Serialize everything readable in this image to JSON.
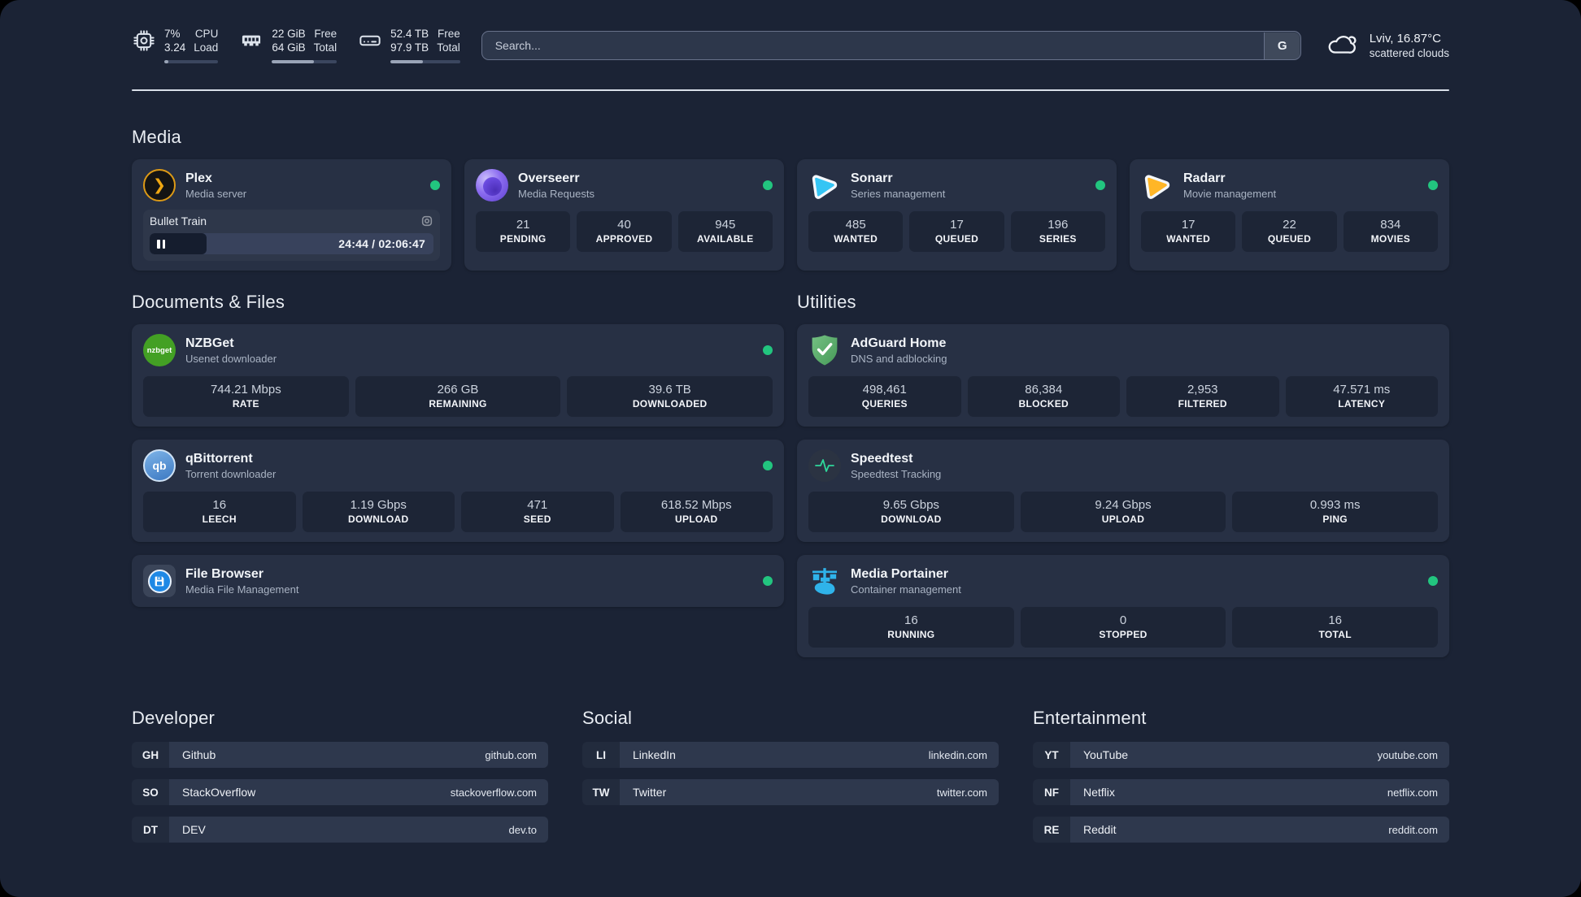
{
  "header": {
    "system": {
      "cpu": {
        "value_top": "7%",
        "value_bottom": "3.24",
        "label_top": "CPU",
        "label_bottom": "Load",
        "progress": 7
      },
      "ram": {
        "value_top": "22 GiB",
        "value_bottom": "64 GiB",
        "label_top": "Free",
        "label_bottom": "Total",
        "progress": 65
      },
      "disk": {
        "value_top": "52.4 TB",
        "value_bottom": "97.9 TB",
        "label_top": "Free",
        "label_bottom": "Total",
        "progress": 47
      }
    },
    "search": {
      "placeholder": "Search...",
      "button_label": "G"
    },
    "weather": {
      "location": "Lviv, 16.87°C",
      "condition": "scattered clouds"
    }
  },
  "sections": {
    "media": "Media",
    "documents": "Documents & Files",
    "utilities": "Utilities",
    "developer": "Developer",
    "social": "Social",
    "entertainment": "Entertainment"
  },
  "media_cards": {
    "plex": {
      "title": "Plex",
      "subtitle": "Media server",
      "player": {
        "track": "Bullet Train",
        "time": "24:44 / 02:06:47",
        "progress": 20
      }
    },
    "overseerr": {
      "title": "Overseerr",
      "subtitle": "Media Requests",
      "stats": [
        {
          "value": "21",
          "label": "PENDING"
        },
        {
          "value": "40",
          "label": "APPROVED"
        },
        {
          "value": "945",
          "label": "AVAILABLE"
        }
      ]
    },
    "sonarr": {
      "title": "Sonarr",
      "subtitle": "Series management",
      "stats": [
        {
          "value": "485",
          "label": "WANTED"
        },
        {
          "value": "17",
          "label": "QUEUED"
        },
        {
          "value": "196",
          "label": "SERIES"
        }
      ]
    },
    "radarr": {
      "title": "Radarr",
      "subtitle": "Movie management",
      "stats": [
        {
          "value": "17",
          "label": "WANTED"
        },
        {
          "value": "22",
          "label": "QUEUED"
        },
        {
          "value": "834",
          "label": "MOVIES"
        }
      ]
    }
  },
  "documents_cards": {
    "nzbget": {
      "title": "NZBGet",
      "subtitle": "Usenet downloader",
      "icon_text": "nzbget",
      "stats": [
        {
          "value": "744.21 Mbps",
          "label": "RATE"
        },
        {
          "value": "266 GB",
          "label": "REMAINING"
        },
        {
          "value": "39.6 TB",
          "label": "DOWNLOADED"
        }
      ]
    },
    "qbittorrent": {
      "title": "qBittorrent",
      "subtitle": "Torrent downloader",
      "icon_text": "qb",
      "stats": [
        {
          "value": "16",
          "label": "LEECH"
        },
        {
          "value": "1.19 Gbps",
          "label": "DOWNLOAD"
        },
        {
          "value": "471",
          "label": "SEED"
        },
        {
          "value": "618.52 Mbps",
          "label": "UPLOAD"
        }
      ]
    },
    "filebrowser": {
      "title": "File Browser",
      "subtitle": "Media File Management"
    }
  },
  "utilities_cards": {
    "adguard": {
      "title": "AdGuard Home",
      "subtitle": "DNS and adblocking",
      "stats": [
        {
          "value": "498,461",
          "label": "QUERIES"
        },
        {
          "value": "86,384",
          "label": "BLOCKED"
        },
        {
          "value": "2,953",
          "label": "FILTERED"
        },
        {
          "value": "47.571 ms",
          "label": "LATENCY"
        }
      ]
    },
    "speedtest": {
      "title": "Speedtest",
      "subtitle": "Speedtest Tracking",
      "stats": [
        {
          "value": "9.65 Gbps",
          "label": "DOWNLOAD"
        },
        {
          "value": "9.24 Gbps",
          "label": "UPLOAD"
        },
        {
          "value": "0.993 ms",
          "label": "PING"
        }
      ]
    },
    "portainer": {
      "title": "Media Portainer",
      "subtitle": "Container management",
      "stats": [
        {
          "value": "16",
          "label": "RUNNING"
        },
        {
          "value": "0",
          "label": "STOPPED"
        },
        {
          "value": "16",
          "label": "TOTAL"
        }
      ]
    }
  },
  "links": {
    "developer": [
      {
        "tag": "GH",
        "name": "Github",
        "url": "github.com"
      },
      {
        "tag": "SO",
        "name": "StackOverflow",
        "url": "stackoverflow.com"
      },
      {
        "tag": "DT",
        "name": "DEV",
        "url": "dev.to"
      }
    ],
    "social": [
      {
        "tag": "LI",
        "name": "LinkedIn",
        "url": "linkedin.com"
      },
      {
        "tag": "TW",
        "name": "Twitter",
        "url": "twitter.com"
      }
    ],
    "entertainment": [
      {
        "tag": "YT",
        "name": "YouTube",
        "url": "youtube.com"
      },
      {
        "tag": "NF",
        "name": "Netflix",
        "url": "netflix.com"
      },
      {
        "tag": "RE",
        "name": "Reddit",
        "url": "reddit.com"
      }
    ]
  },
  "colors": {
    "status_online": "#22c57f",
    "panel_bg": "#1b2335",
    "card_bg": "#273044"
  }
}
